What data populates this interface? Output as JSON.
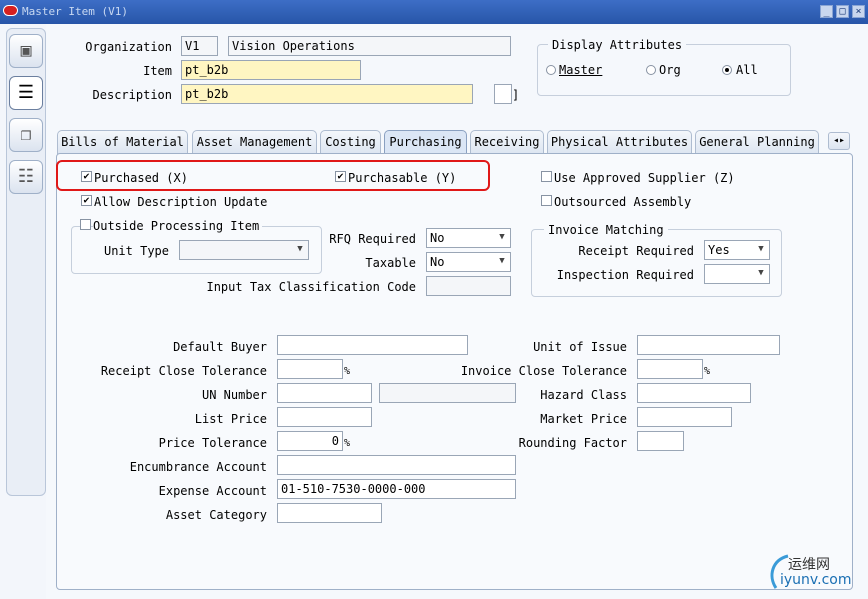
{
  "window": {
    "title": "Master Item (V1)"
  },
  "colors": {
    "titlebar": "#2755a8",
    "required_field": "#fff6c2",
    "highlight": "#e01818"
  },
  "header": {
    "organization_label": "Organization",
    "organization_code": "V1",
    "organization_name": "Vision Operations",
    "item_label": "Item",
    "item_value": "pt_b2b",
    "description_label": "Description",
    "description_value": "pt_b2b",
    "description_suffix": "]"
  },
  "display_attributes": {
    "title": "Display Attributes",
    "options": [
      "Master",
      "Org",
      "All"
    ],
    "selected": "All"
  },
  "tabs": [
    "Bills of Material",
    "Asset Management",
    "Costing",
    "Purchasing",
    "Receiving",
    "Physical Attributes",
    "General Planning"
  ],
  "active_tab": "Purchasing",
  "purchasing": {
    "purchased": {
      "label": "Purchased (X)",
      "checked": true
    },
    "purchasable": {
      "label": "Purchasable (Y)",
      "checked": true
    },
    "use_approved_supplier": {
      "label": "Use Approved Supplier (Z)",
      "checked": false
    },
    "allow_description_update": {
      "label": "Allow Description Update",
      "checked": true
    },
    "outsourced_assembly": {
      "label": "Outsourced Assembly",
      "checked": false
    },
    "outside_processing_item": {
      "label": "Outside Processing Item",
      "checked": false
    },
    "unit_type_label": "Unit Type",
    "unit_type_value": "",
    "rfq_required_label": "RFQ Required",
    "rfq_required_value": "No",
    "taxable_label": "Taxable",
    "taxable_value": "No",
    "input_tax_label": "Input Tax Classification Code",
    "input_tax_value": "",
    "invoice_matching": {
      "title": "Invoice Matching",
      "receipt_required_label": "Receipt Required",
      "receipt_required_value": "Yes",
      "inspection_required_label": "Inspection Required",
      "inspection_required_value": ""
    },
    "fields": {
      "default_buyer": {
        "label": "Default Buyer",
        "value": ""
      },
      "receipt_close_tolerance": {
        "label": "Receipt Close Tolerance",
        "value": "",
        "unit": "%"
      },
      "un_number": {
        "label": "UN Number",
        "value": "",
        "desc": ""
      },
      "list_price": {
        "label": "List Price",
        "value": ""
      },
      "price_tolerance": {
        "label": "Price Tolerance",
        "value": "0",
        "unit": "%"
      },
      "encumbrance_account": {
        "label": "Encumbrance Account",
        "value": ""
      },
      "expense_account": {
        "label": "Expense Account",
        "value": "01-510-7530-0000-000"
      },
      "asset_category": {
        "label": "Asset Category",
        "value": ""
      },
      "unit_of_issue": {
        "label": "Unit of Issue",
        "value": ""
      },
      "invoice_close_tolerance": {
        "label": "Invoice Close Tolerance",
        "value": "",
        "unit": "%"
      },
      "hazard_class": {
        "label": "Hazard Class",
        "value": ""
      },
      "market_price": {
        "label": "Market Price",
        "value": ""
      },
      "rounding_factor": {
        "label": "Rounding Factor",
        "value": ""
      }
    }
  },
  "watermark": {
    "text_cn": "运维网",
    "text": "iyunv.com"
  }
}
